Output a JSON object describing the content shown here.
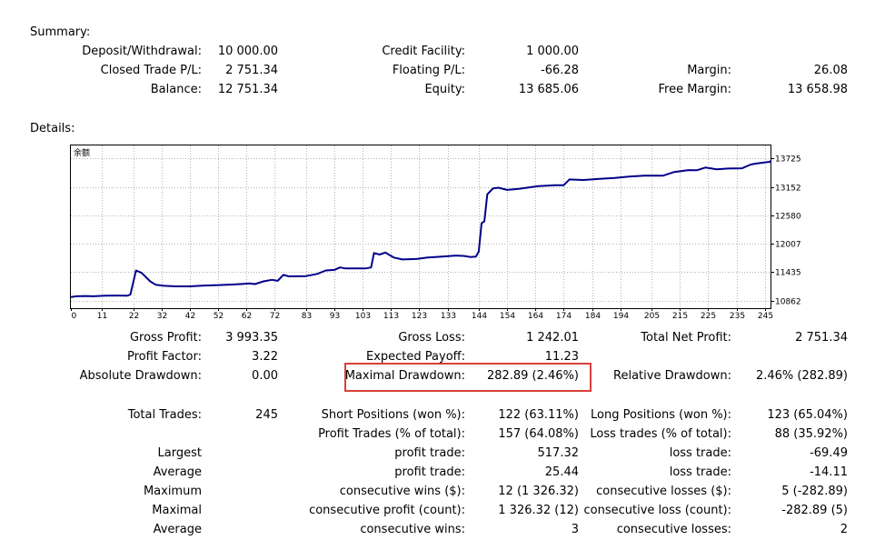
{
  "summary": {
    "heading": "Summary:",
    "deposit_label": "Deposit/Withdrawal:",
    "deposit_value": "10 000.00",
    "credit_label": "Credit Facility:",
    "credit_value": "1 000.00",
    "closed_pl_label": "Closed Trade P/L:",
    "closed_pl_value": "2 751.34",
    "floating_label": "Floating P/L:",
    "floating_value": "-66.28",
    "margin_label": "Margin:",
    "margin_value": "26.08",
    "balance_label": "Balance:",
    "balance_value": "12 751.34",
    "equity_label": "Equity:",
    "equity_value": "13 685.06",
    "free_margin_label": "Free Margin:",
    "free_margin_value": "13 658.98"
  },
  "details": {
    "heading": "Details:",
    "gross_profit_label": "Gross Profit:",
    "gross_profit_value": "3 993.35",
    "gross_loss_label": "Gross Loss:",
    "gross_loss_value": "1 242.01",
    "net_profit_label": "Total Net Profit:",
    "net_profit_value": "2 751.34",
    "profit_factor_label": "Profit Factor:",
    "profit_factor_value": "3.22",
    "expected_payoff_label": "Expected Payoff:",
    "expected_payoff_value": "11.23",
    "abs_dd_label": "Absolute Drawdown:",
    "abs_dd_value": "0.00",
    "max_dd_label": "Maximal Drawdown:",
    "max_dd_value": "282.89 (2.46%)",
    "rel_dd_label": "Relative Drawdown:",
    "rel_dd_value": "2.46% (282.89)",
    "total_trades_label": "Total Trades:",
    "total_trades_value": "245",
    "short_label": "Short Positions (won %):",
    "short_value": "122 (63.11%)",
    "long_label": "Long Positions (won %):",
    "long_value": "123 (65.04%)",
    "profit_trades_label": "Profit Trades (% of total):",
    "profit_trades_value": "157 (64.08%)",
    "loss_trades_label": "Loss trades (% of total):",
    "loss_trades_value": "88 (35.92%)",
    "largest_label": "Largest",
    "largest_profit_label": "profit trade:",
    "largest_profit_value": "517.32",
    "largest_loss_label": "loss trade:",
    "largest_loss_value": "-69.49",
    "average_label": "Average",
    "average_profit_label": "profit trade:",
    "average_profit_value": "25.44",
    "average_loss_label": "loss trade:",
    "average_loss_value": "-14.11",
    "maximum_label": "Maximum",
    "max_cons_wins_label": "consecutive wins ($):",
    "max_cons_wins_value": "12 (1 326.32)",
    "max_cons_losses_label": "consecutive losses ($):",
    "max_cons_losses_value": "5 (-282.89)",
    "maximal_label": "Maximal",
    "maximal_profit_label": "consecutive profit (count):",
    "maximal_profit_value": "1 326.32 (12)",
    "maximal_loss_label": "consecutive loss (count):",
    "maximal_loss_value": "-282.89 (5)",
    "avg2_label": "Average",
    "avg_cons_wins_label": "consecutive wins:",
    "avg_cons_wins_value": "3",
    "avg_cons_losses_label": "consecutive losses:",
    "avg_cons_losses_value": "2"
  },
  "colors": {
    "line": "#00008b",
    "grid": "#b4b4b4",
    "highlight": "#d9403a"
  },
  "chart_data": {
    "type": "line",
    "chart_label": "余额",
    "x_ticks": [
      0,
      11,
      22,
      32,
      42,
      52,
      62,
      72,
      83,
      93,
      103,
      113,
      123,
      133,
      144,
      154,
      164,
      174,
      184,
      194,
      205,
      215,
      225,
      235,
      245
    ],
    "y_ticks": [
      10862,
      11435,
      12007,
      12580,
      13152,
      13725
    ],
    "xlim": [
      0,
      247
    ],
    "ylim": [
      10710,
      13985
    ],
    "grid": true,
    "series": [
      {
        "values": [
          [
            0,
            10935
          ],
          [
            2,
            10950
          ],
          [
            5,
            10955
          ],
          [
            8,
            10950
          ],
          [
            12,
            10960
          ],
          [
            16,
            10965
          ],
          [
            20,
            10962
          ],
          [
            21,
            10985
          ],
          [
            23,
            11470
          ],
          [
            25,
            11420
          ],
          [
            28,
            11250
          ],
          [
            30,
            11180
          ],
          [
            33,
            11160
          ],
          [
            37,
            11150
          ],
          [
            42,
            11150
          ],
          [
            47,
            11165
          ],
          [
            52,
            11175
          ],
          [
            57,
            11185
          ],
          [
            61,
            11200
          ],
          [
            63,
            11210
          ],
          [
            65,
            11195
          ],
          [
            68,
            11250
          ],
          [
            71,
            11280
          ],
          [
            73,
            11260
          ],
          [
            75,
            11380
          ],
          [
            77,
            11350
          ],
          [
            83,
            11355
          ],
          [
            87,
            11400
          ],
          [
            90,
            11470
          ],
          [
            93,
            11480
          ],
          [
            95,
            11530
          ],
          [
            97,
            11510
          ],
          [
            104,
            11510
          ],
          [
            106,
            11530
          ],
          [
            107,
            11820
          ],
          [
            109,
            11790
          ],
          [
            111,
            11830
          ],
          [
            114,
            11730
          ],
          [
            117,
            11690
          ],
          [
            122,
            11700
          ],
          [
            126,
            11730
          ],
          [
            131,
            11750
          ],
          [
            136,
            11770
          ],
          [
            139,
            11760
          ],
          [
            141,
            11740
          ],
          [
            143,
            11750
          ],
          [
            144,
            11850
          ],
          [
            145,
            12420
          ],
          [
            146,
            12460
          ],
          [
            147,
            13000
          ],
          [
            149,
            13120
          ],
          [
            151,
            13135
          ],
          [
            154,
            13090
          ],
          [
            158,
            13110
          ],
          [
            161,
            13135
          ],
          [
            165,
            13165
          ],
          [
            171,
            13185
          ],
          [
            174,
            13185
          ],
          [
            176,
            13300
          ],
          [
            181,
            13290
          ],
          [
            186,
            13310
          ],
          [
            192,
            13330
          ],
          [
            197,
            13360
          ],
          [
            203,
            13380
          ],
          [
            209,
            13375
          ],
          [
            213,
            13450
          ],
          [
            218,
            13490
          ],
          [
            221,
            13485
          ],
          [
            224,
            13540
          ],
          [
            228,
            13505
          ],
          [
            232,
            13520
          ],
          [
            237,
            13525
          ],
          [
            240,
            13600
          ],
          [
            242,
            13620
          ],
          [
            246,
            13650
          ],
          [
            250,
            13655
          ],
          [
            255,
            13670
          ],
          [
            258,
            13680
          ],
          [
            262,
            13685
          ]
        ]
      }
    ]
  }
}
